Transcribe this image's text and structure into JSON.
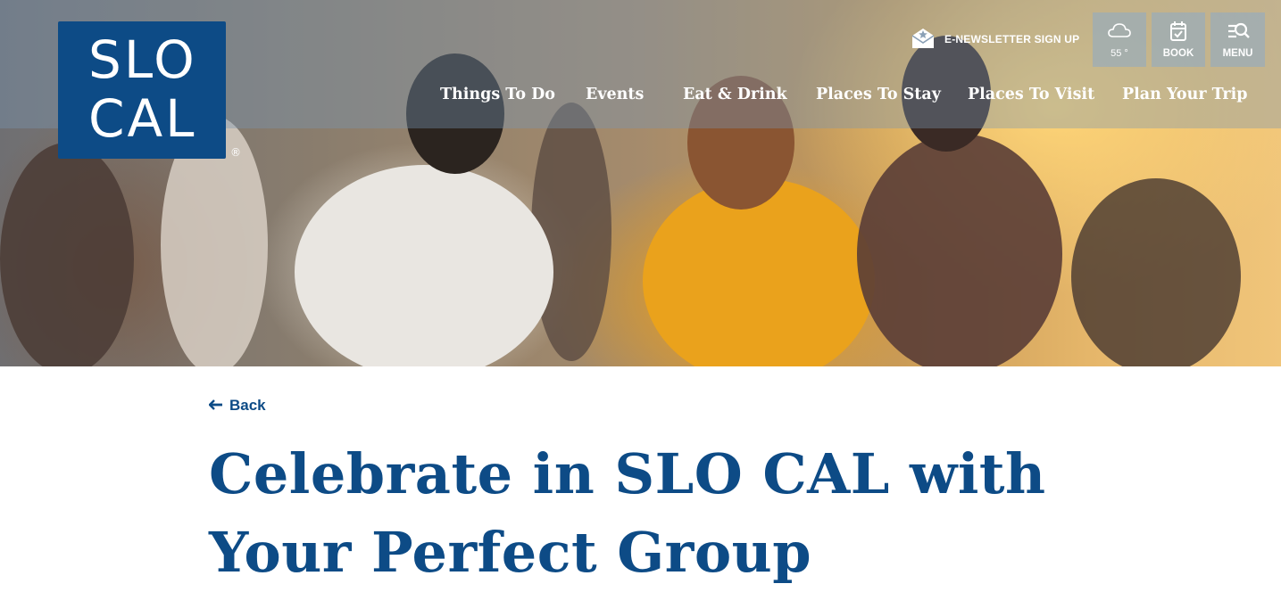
{
  "brand": {
    "logo_line1": "SLO",
    "logo_line2": "CAL",
    "registered": "®"
  },
  "utility": {
    "newsletter_label": "E-NEWSLETTER SIGN UP",
    "weather_temp": "55 °",
    "book_label": "BOOK",
    "menu_label": "MENU"
  },
  "nav": {
    "items": [
      {
        "label": "Things To Do"
      },
      {
        "label": "Events"
      },
      {
        "label": "Eat & Drink"
      },
      {
        "label": "Places To Stay"
      },
      {
        "label": "Places To Visit"
      },
      {
        "label": "Plan Your Trip"
      }
    ]
  },
  "content": {
    "back_label": "Back",
    "title_line1": "Celebrate in SLO CAL with",
    "title_line2": "Your Perfect Group"
  },
  "colors": {
    "brand_blue": "#0d4b86",
    "nav_overlay": "#7896b4",
    "text_white": "#ffffff"
  },
  "icons": [
    "envelope-star-icon",
    "cloud-icon",
    "calendar-check-icon",
    "search-menu-icon",
    "arrow-left-icon"
  ]
}
